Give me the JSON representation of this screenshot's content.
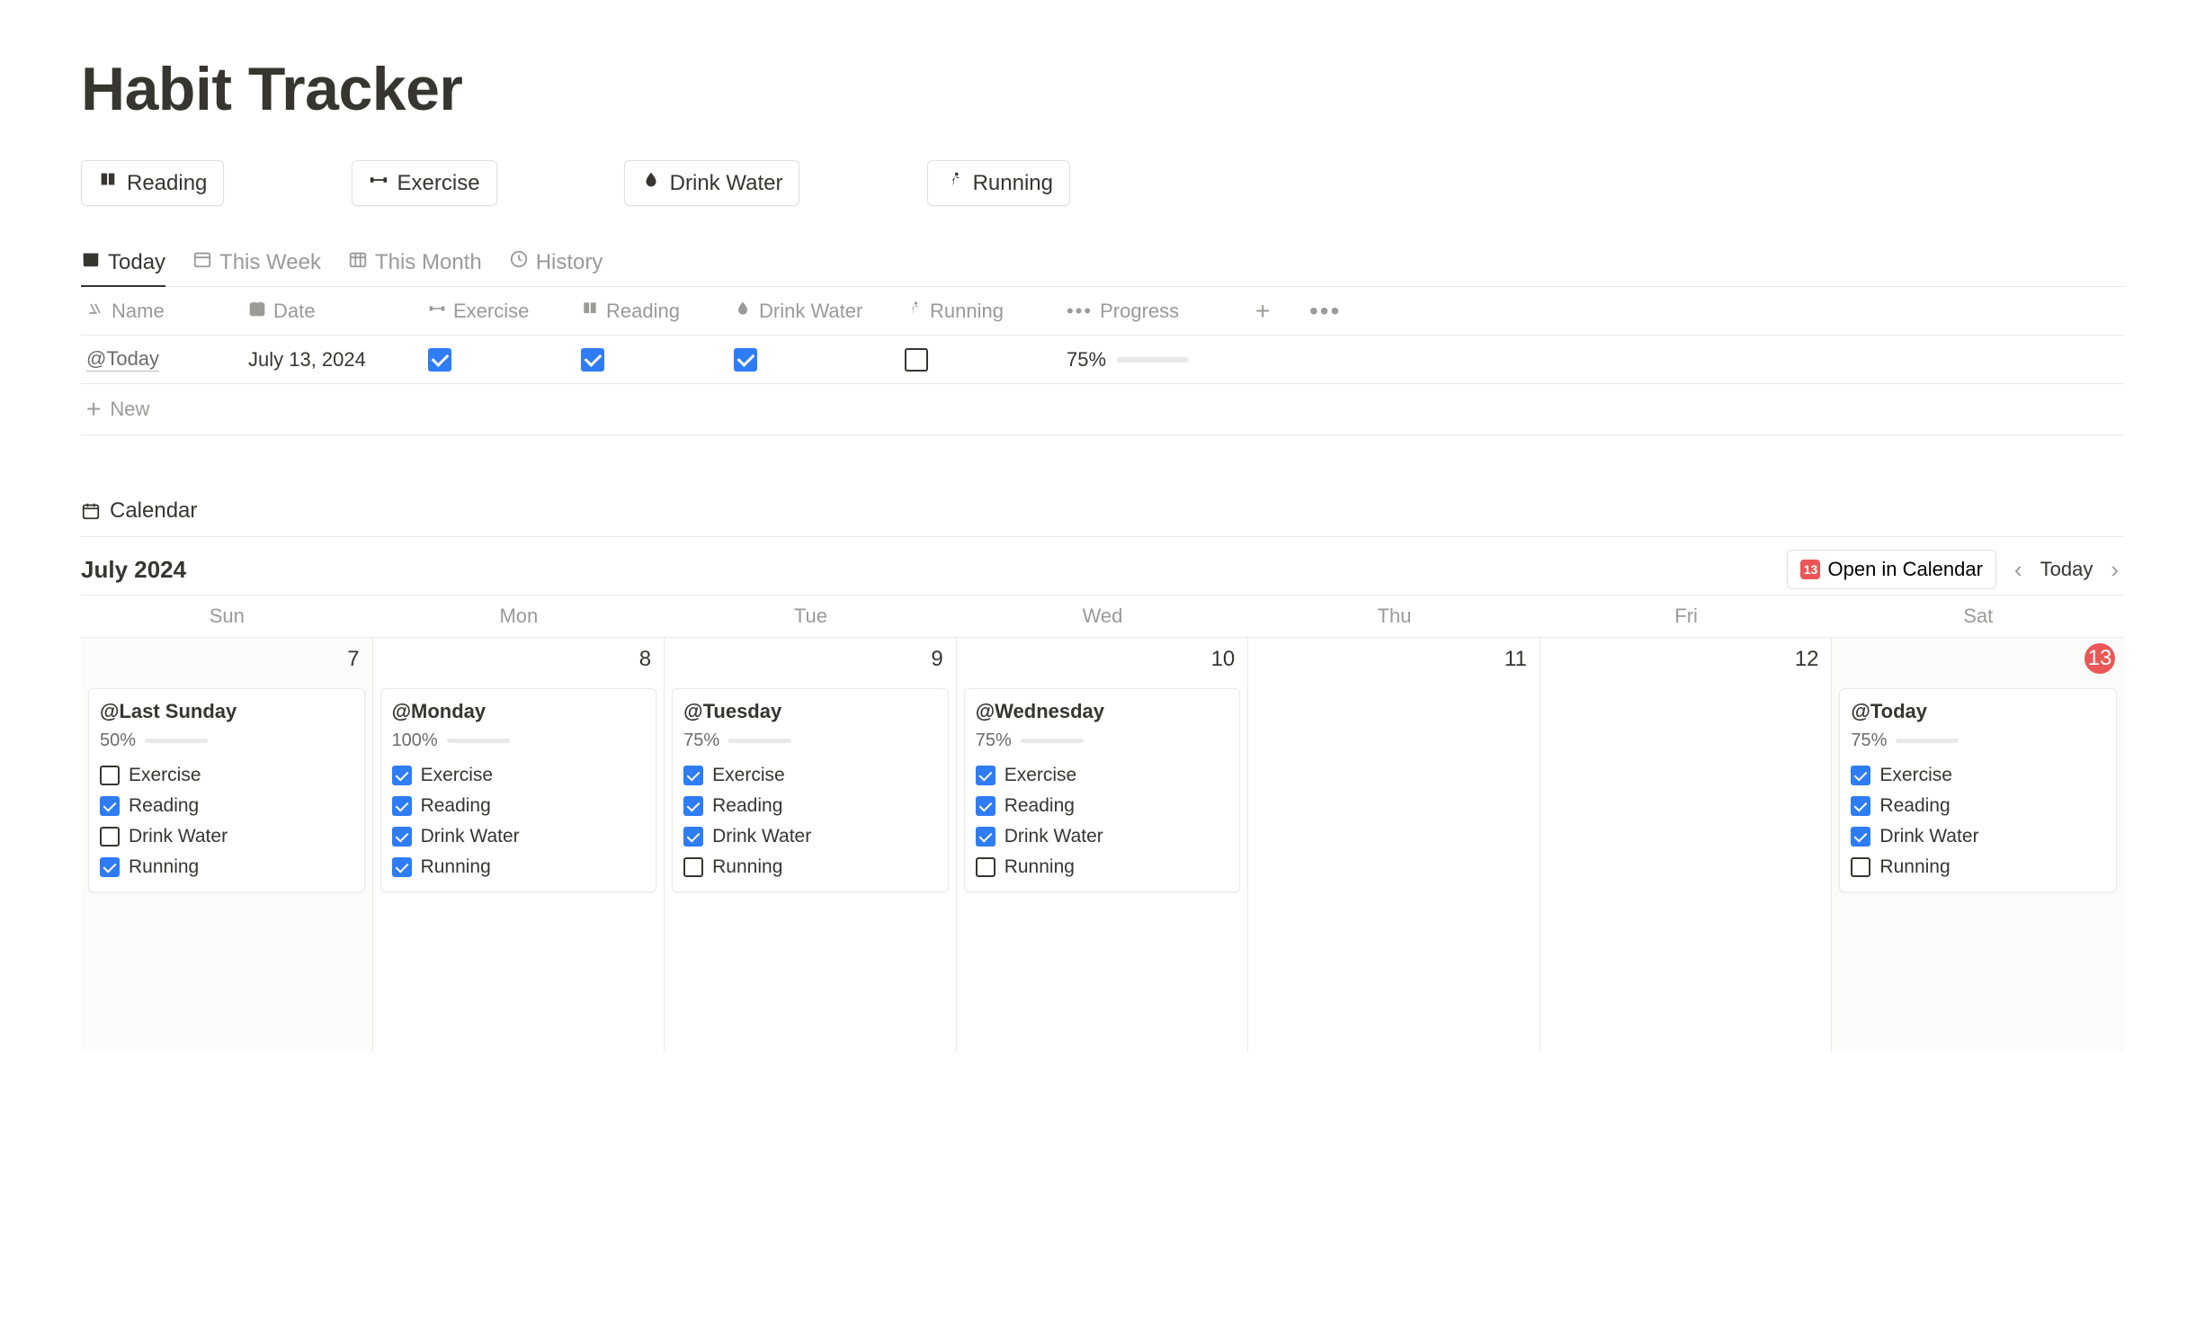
{
  "title": "Habit Tracker",
  "habit_buttons": [
    {
      "id": "reading",
      "label": "Reading"
    },
    {
      "id": "exercise",
      "label": "Exercise"
    },
    {
      "id": "drink-water",
      "label": "Drink Water"
    },
    {
      "id": "running",
      "label": "Running"
    }
  ],
  "views": [
    {
      "id": "today",
      "label": "Today",
      "active": true
    },
    {
      "id": "this-week",
      "label": "This Week",
      "active": false
    },
    {
      "id": "this-month",
      "label": "This Month",
      "active": false
    },
    {
      "id": "history",
      "label": "History",
      "active": false
    }
  ],
  "table": {
    "columns": [
      {
        "id": "name",
        "label": "Name"
      },
      {
        "id": "date",
        "label": "Date"
      },
      {
        "id": "exercise",
        "label": "Exercise"
      },
      {
        "id": "reading",
        "label": "Reading"
      },
      {
        "id": "drink-water",
        "label": "Drink Water"
      },
      {
        "id": "running",
        "label": "Running"
      },
      {
        "id": "progress",
        "label": "Progress"
      }
    ],
    "row": {
      "name": "@Today",
      "date": "July 13, 2024",
      "exercise": true,
      "reading": true,
      "drink_water": true,
      "running": false,
      "progress_label": "75%",
      "progress_pct": 75
    },
    "new_label": "New"
  },
  "calendar": {
    "label": "Calendar",
    "month_label": "July 2024",
    "open_btn": "Open in Calendar",
    "open_btn_badge": "13",
    "today_btn": "Today",
    "dow": [
      "Sun",
      "Mon",
      "Tue",
      "Wed",
      "Thu",
      "Fri",
      "Sat"
    ],
    "cells": [
      {
        "day": "7",
        "today": false,
        "shaded": true,
        "card": {
          "title": "@Last Sunday",
          "progress_label": "50%",
          "progress_pct": 50,
          "items": [
            {
              "label": "Exercise",
              "checked": false
            },
            {
              "label": "Reading",
              "checked": true
            },
            {
              "label": "Drink Water",
              "checked": false
            },
            {
              "label": "Running",
              "checked": true
            }
          ]
        }
      },
      {
        "day": "8",
        "today": false,
        "shaded": false,
        "card": {
          "title": "@Monday",
          "progress_label": "100%",
          "progress_pct": 100,
          "items": [
            {
              "label": "Exercise",
              "checked": true
            },
            {
              "label": "Reading",
              "checked": true
            },
            {
              "label": "Drink Water",
              "checked": true
            },
            {
              "label": "Running",
              "checked": true
            }
          ]
        }
      },
      {
        "day": "9",
        "today": false,
        "shaded": false,
        "card": {
          "title": "@Tuesday",
          "progress_label": "75%",
          "progress_pct": 75,
          "items": [
            {
              "label": "Exercise",
              "checked": true
            },
            {
              "label": "Reading",
              "checked": true
            },
            {
              "label": "Drink Water",
              "checked": true
            },
            {
              "label": "Running",
              "checked": false
            }
          ]
        }
      },
      {
        "day": "10",
        "today": false,
        "shaded": false,
        "card": {
          "title": "@Wednesday",
          "progress_label": "75%",
          "progress_pct": 75,
          "items": [
            {
              "label": "Exercise",
              "checked": true
            },
            {
              "label": "Reading",
              "checked": true
            },
            {
              "label": "Drink Water",
              "checked": true
            },
            {
              "label": "Running",
              "checked": false
            }
          ]
        }
      },
      {
        "day": "11",
        "today": false,
        "shaded": false,
        "card": null
      },
      {
        "day": "12",
        "today": false,
        "shaded": false,
        "card": null
      },
      {
        "day": "13",
        "today": true,
        "shaded": true,
        "card": {
          "title": "@Today",
          "progress_label": "75%",
          "progress_pct": 75,
          "items": [
            {
              "label": "Exercise",
              "checked": true
            },
            {
              "label": "Reading",
              "checked": true
            },
            {
              "label": "Drink Water",
              "checked": true
            },
            {
              "label": "Running",
              "checked": false
            }
          ]
        }
      }
    ]
  }
}
